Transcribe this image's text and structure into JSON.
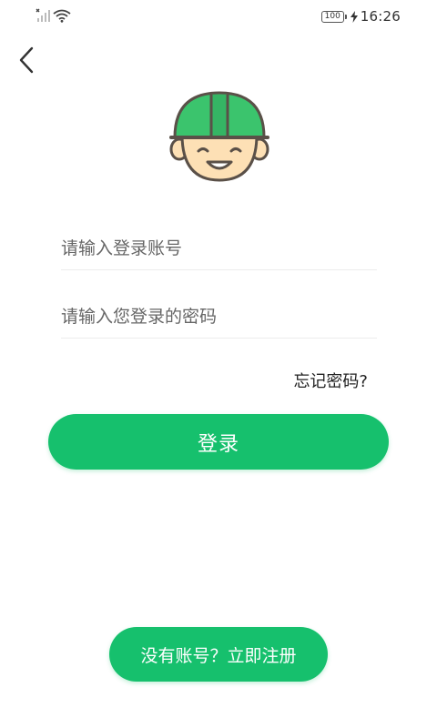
{
  "status_bar": {
    "battery": "100",
    "time": "16:26"
  },
  "login_form": {
    "account_placeholder": "请输入登录账号",
    "password_placeholder": "请输入您登录的密码",
    "forgot_password": "忘记密码?",
    "login_button": "登录"
  },
  "footer": {
    "register_button": "没有账号？立即注册"
  },
  "colors": {
    "primary": "#16c06d",
    "helmet": "#3bc46d",
    "face": "#fde0b5",
    "outline": "#5a5048"
  },
  "icons": {
    "back": "chevron-left-icon",
    "avatar": "worker-helmet-avatar-icon"
  }
}
